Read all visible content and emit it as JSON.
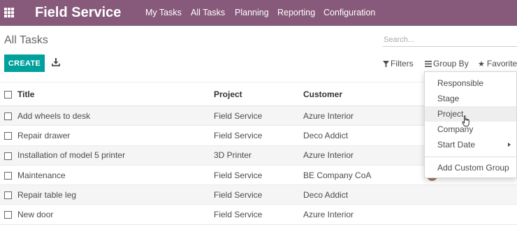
{
  "navbar": {
    "app_name": "Field Service",
    "menu": [
      "My Tasks",
      "All Tasks",
      "Planning",
      "Reporting",
      "Configuration"
    ],
    "color": "#875a7b"
  },
  "control_panel": {
    "title": "All Tasks",
    "search_placeholder": "Search...",
    "create_label": "CREATE",
    "filters_label": "Filters",
    "group_by_label": "Group By",
    "favorites_label": "Favorites"
  },
  "table": {
    "columns": [
      "Title",
      "Project",
      "Customer"
    ],
    "rows": [
      {
        "title": "Add wheels to desk",
        "project": "Field Service",
        "customer": "Azure Interior"
      },
      {
        "title": "Repair drawer",
        "project": "Field Service",
        "customer": "Deco Addict"
      },
      {
        "title": "Installation of model 5 printer",
        "project": "3D Printer",
        "customer": "Azure Interior"
      },
      {
        "title": "Maintenance",
        "project": "Field Service",
        "customer": "BE Company CoA"
      },
      {
        "title": "Repair table leg",
        "project": "Field Service",
        "customer": "Deco Addict"
      },
      {
        "title": "New door",
        "project": "Field Service",
        "customer": "Azure Interior"
      }
    ]
  },
  "group_by_menu": {
    "items": [
      "Responsible",
      "Stage",
      "Project",
      "Company",
      "Start Date"
    ],
    "hovered_item": "Project",
    "custom_group_label": "Add Custom Group"
  },
  "colors": {
    "brand": "#875a7b",
    "primary_button": "#00a09d"
  }
}
